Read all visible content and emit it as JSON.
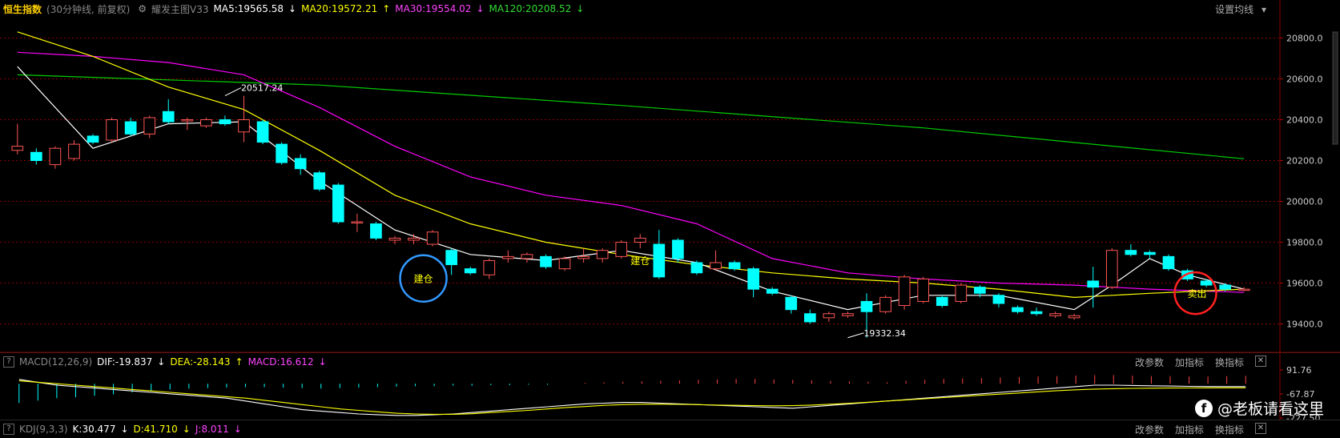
{
  "header": {
    "title": "恒生指数",
    "period": "(30分钟线, 前复权)",
    "indicator_name": "耀发主图V33",
    "ma5": "MA5:19565.58",
    "ma20": "MA20:19572.21",
    "ma30": "MA30:19554.02",
    "ma120": "MA120:20208.52",
    "set_ma": "设置均线"
  },
  "macd_header": {
    "name": "MACD(12,26,9)",
    "dif": "DIF:-19.837",
    "dea": "DEA:-28.143",
    "macd": "MACD:16.612",
    "links": [
      "改参数",
      "加指标",
      "换指标"
    ]
  },
  "kdj_header": {
    "name": "KDJ(9,3,3)",
    "k": "K:30.477",
    "d": "D:41.710",
    "j": "J:8.011",
    "links": [
      "改参数",
      "加指标",
      "换指标"
    ]
  },
  "watermark": "@老板请看这里",
  "colors": {
    "up": "#ff5555",
    "down": "#00ffff",
    "ma5": "#ffffff",
    "ma20": "#ffff00",
    "ma30": "#ff00ff",
    "ma120": "#00cc00",
    "grid": "#8b0000"
  },
  "chart_data": {
    "type": "candlestick",
    "ylim": [
      19300,
      20900
    ],
    "yticks": [
      "20800.0",
      "20600.0",
      "20400.0",
      "20200.0",
      "20000.0",
      "19800.0",
      "19600.0",
      "19400.0"
    ],
    "macd_ticks": [
      "91.76",
      "-67.87",
      "-227.50"
    ],
    "annotations": [
      {
        "text": "20517.24",
        "index": 11,
        "value": 20517.24
      },
      {
        "text": "19332.34",
        "index": 44,
        "value": 19332.34
      },
      {
        "text": "建仓",
        "index": 21,
        "value": 19760,
        "marker": "blue-circle"
      },
      {
        "text": "建仓",
        "index": 33,
        "value": 19740
      },
      {
        "text": "卖出",
        "index": 62,
        "value": 19570,
        "marker": "red-circle"
      }
    ],
    "candles": [
      [
        20250,
        20270,
        20230,
        20380
      ],
      [
        20240,
        20200,
        20180,
        20260
      ],
      [
        20180,
        20260,
        20160,
        20270
      ],
      [
        20210,
        20280,
        20200,
        20300
      ],
      [
        20320,
        20290,
        20280,
        20330
      ],
      [
        20300,
        20400,
        20290,
        20410
      ],
      [
        20390,
        20330,
        20320,
        20410
      ],
      [
        20330,
        20410,
        20310,
        20420
      ],
      [
        20440,
        20390,
        20380,
        20500
      ],
      [
        20400,
        20400,
        20350,
        20410
      ],
      [
        20370,
        20400,
        20360,
        20410
      ],
      [
        20400,
        20380,
        20370,
        20420
      ],
      [
        20340,
        20400,
        20290,
        20517.24
      ],
      [
        20390,
        20290,
        20280,
        20400
      ],
      [
        20280,
        20190,
        20180,
        20290
      ],
      [
        20210,
        20160,
        20130,
        20230
      ],
      [
        20140,
        20060,
        20050,
        20150
      ],
      [
        20080,
        19900,
        19890,
        20090
      ],
      [
        19900,
        19900,
        19850,
        19940
      ],
      [
        19890,
        19820,
        19810,
        19900
      ],
      [
        19810,
        19820,
        19790,
        19830
      ],
      [
        19810,
        19820,
        19790,
        19840
      ],
      [
        19790,
        19850,
        19780,
        19860
      ],
      [
        19760,
        19690,
        19640,
        19770
      ],
      [
        19670,
        19650,
        19640,
        19680
      ],
      [
        19640,
        19710,
        19620,
        19720
      ],
      [
        19720,
        19730,
        19700,
        19760
      ],
      [
        19720,
        19740,
        19700,
        19750
      ],
      [
        19730,
        19680,
        19670,
        19740
      ],
      [
        19670,
        19720,
        19660,
        19730
      ],
      [
        19720,
        19730,
        19700,
        19770
      ],
      [
        19720,
        19760,
        19700,
        19770
      ],
      [
        19730,
        19800,
        19720,
        19810
      ],
      [
        19800,
        19820,
        19770,
        19840
      ],
      [
        19790,
        19630,
        19620,
        19860
      ],
      [
        19810,
        19720,
        19700,
        19820
      ],
      [
        19700,
        19650,
        19640,
        19710
      ],
      [
        19670,
        19700,
        19660,
        19760
      ],
      [
        19700,
        19670,
        19660,
        19710
      ],
      [
        19670,
        19570,
        19530,
        19680
      ],
      [
        19570,
        19550,
        19540,
        19580
      ],
      [
        19530,
        19470,
        19450,
        19540
      ],
      [
        19450,
        19410,
        19400,
        19470
      ],
      [
        19430,
        19450,
        19410,
        19460
      ],
      [
        19440,
        19450,
        19430,
        19460
      ],
      [
        19510,
        19460,
        19332.34,
        19550
      ],
      [
        19460,
        19530,
        19450,
        19540
      ],
      [
        19490,
        19630,
        19470,
        19640
      ],
      [
        19510,
        19620,
        19500,
        19630
      ],
      [
        19530,
        19490,
        19480,
        19540
      ],
      [
        19510,
        19590,
        19500,
        19600
      ],
      [
        19580,
        19550,
        19530,
        19590
      ],
      [
        19540,
        19500,
        19480,
        19550
      ],
      [
        19480,
        19460,
        19450,
        19490
      ],
      [
        19460,
        19450,
        19440,
        19480
      ],
      [
        19440,
        19450,
        19430,
        19460
      ],
      [
        19430,
        19440,
        19420,
        19450
      ],
      [
        19610,
        19580,
        19480,
        19680
      ],
      [
        19580,
        19760,
        19570,
        19770
      ],
      [
        19760,
        19740,
        19730,
        19790
      ],
      [
        19750,
        19740,
        19720,
        19760
      ],
      [
        19730,
        19670,
        19660,
        19740
      ],
      [
        19660,
        19620,
        19610,
        19670
      ],
      [
        19610,
        19590,
        19580,
        19620
      ],
      [
        19590,
        19570,
        19560,
        19600
      ],
      [
        19570,
        19570,
        19560,
        19580
      ]
    ],
    "ma5": [
      [
        0,
        20660
      ],
      [
        4,
        20260
      ],
      [
        8,
        20380
      ],
      [
        12,
        20390
      ],
      [
        16,
        20100
      ],
      [
        20,
        19860
      ],
      [
        24,
        19740
      ],
      [
        28,
        19710
      ],
      [
        32,
        19760
      ],
      [
        36,
        19700
      ],
      [
        40,
        19560
      ],
      [
        44,
        19470
      ],
      [
        48,
        19540
      ],
      [
        52,
        19540
      ],
      [
        56,
        19470
      ],
      [
        58,
        19590
      ],
      [
        60,
        19720
      ],
      [
        62,
        19640
      ],
      [
        65,
        19570
      ]
    ],
    "ma20": [
      [
        0,
        20830
      ],
      [
        4,
        20710
      ],
      [
        8,
        20560
      ],
      [
        12,
        20450
      ],
      [
        16,
        20250
      ],
      [
        20,
        20030
      ],
      [
        24,
        19890
      ],
      [
        28,
        19800
      ],
      [
        32,
        19740
      ],
      [
        36,
        19690
      ],
      [
        40,
        19650
      ],
      [
        44,
        19620
      ],
      [
        48,
        19600
      ],
      [
        52,
        19570
      ],
      [
        56,
        19530
      ],
      [
        60,
        19550
      ],
      [
        65,
        19570
      ]
    ],
    "ma30": [
      [
        0,
        20730
      ],
      [
        4,
        20710
      ],
      [
        8,
        20680
      ],
      [
        12,
        20620
      ],
      [
        16,
        20460
      ],
      [
        20,
        20270
      ],
      [
        24,
        20120
      ],
      [
        28,
        20030
      ],
      [
        32,
        19980
      ],
      [
        36,
        19890
      ],
      [
        40,
        19720
      ],
      [
        44,
        19650
      ],
      [
        48,
        19620
      ],
      [
        52,
        19600
      ],
      [
        56,
        19590
      ],
      [
        60,
        19570
      ],
      [
        65,
        19554
      ]
    ],
    "ma120": [
      [
        0,
        20620
      ],
      [
        16,
        20570
      ],
      [
        32,
        20470
      ],
      [
        48,
        20360
      ],
      [
        65,
        20208.52
      ]
    ],
    "macd_bars": [
      -40,
      -35,
      -30,
      -28,
      -25,
      -22,
      -18,
      -15,
      -12,
      -10,
      -9,
      -8,
      -7,
      -7,
      -8,
      -9,
      -10,
      -9,
      -8,
      -7,
      -6,
      -5,
      -5,
      -4,
      -4,
      -3,
      -3,
      -2,
      -2,
      0,
      2,
      3,
      4,
      5,
      6,
      7,
      8,
      9,
      10,
      10,
      9,
      8,
      7,
      6,
      5,
      4,
      3,
      6,
      8,
      10,
      11,
      12,
      13,
      14,
      15,
      16,
      17,
      18,
      18,
      17,
      16,
      16,
      15,
      15,
      16,
      16.612
    ],
    "dif": [
      30,
      10,
      -10,
      -20,
      -30,
      -40,
      -50,
      -60,
      -70,
      -80,
      -90,
      -100,
      -120,
      -140,
      -160,
      -180,
      -190,
      -200,
      -210,
      -215,
      -220,
      -220,
      -215,
      -210,
      -200,
      -190,
      -180,
      -170,
      -160,
      -150,
      -140,
      -135,
      -130,
      -130,
      -135,
      -140,
      -145,
      -150,
      -155,
      -160,
      -165,
      -170,
      -160,
      -150,
      -140,
      -130,
      -120,
      -110,
      -100,
      -90,
      -80,
      -70,
      -60,
      -50,
      -40,
      -30,
      -20,
      -10,
      -10,
      -12,
      -14,
      -16,
      -18,
      -19,
      -19.5,
      -19.837
    ],
    "dea": [
      20,
      10,
      0,
      -10,
      -20,
      -30,
      -40,
      -50,
      -60,
      -70,
      -80,
      -90,
      -100,
      -115,
      -130,
      -145,
      -160,
      -175,
      -185,
      -195,
      -205,
      -210,
      -212,
      -212,
      -208,
      -200,
      -192,
      -185,
      -175,
      -165,
      -158,
      -150,
      -145,
      -142,
      -142,
      -143,
      -145,
      -148,
      -150,
      -152,
      -153,
      -152,
      -148,
      -142,
      -136,
      -128,
      -120,
      -112,
      -104,
      -96,
      -88,
      -80,
      -72,
      -64,
      -56,
      -48,
      -42,
      -37,
      -34,
      -32,
      -31,
      -30,
      -29,
      -28.5,
      -28.3,
      -28.143
    ]
  }
}
